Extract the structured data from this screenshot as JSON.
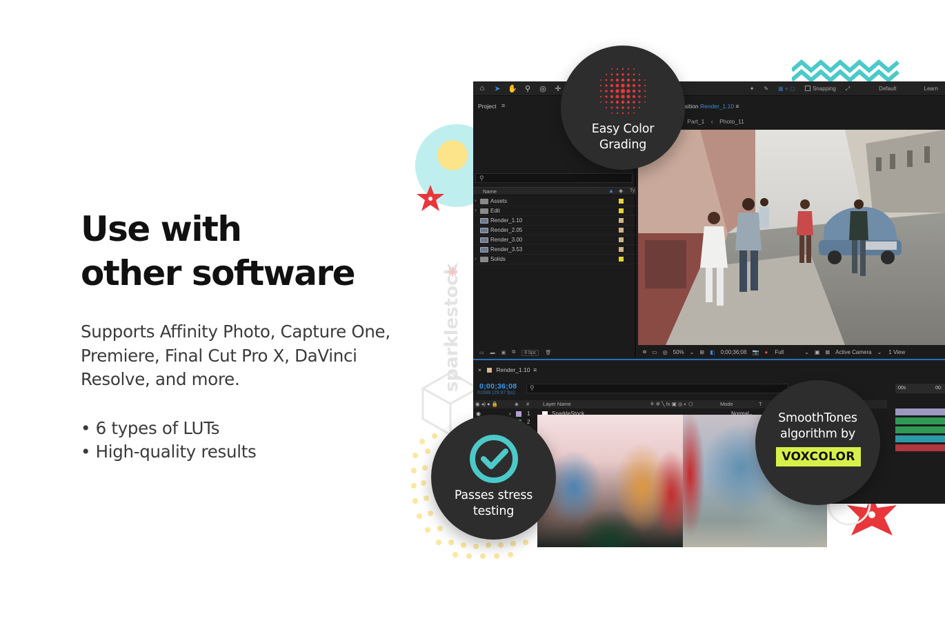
{
  "headline": {
    "line1": "Use with",
    "line2": "other software"
  },
  "description": {
    "line1": "Supports Affinity Photo, Capture One,",
    "line2": "Premiere, Final Cut Pro X, DaVinci",
    "line3": "Resolve, and more."
  },
  "bullets": [
    "• 6 types of LUTs",
    "• High-quality results"
  ],
  "watermark": "sparklestock",
  "badges": {
    "color_grading": {
      "line1": "Easy Color",
      "line2": "Grading"
    },
    "stress": {
      "line1": "Passes stress",
      "line2": "testing"
    },
    "smooth": {
      "line1": "SmoothTones",
      "line2": "algorithm by",
      "brand": "VOXCOLOR"
    }
  },
  "colors": {
    "accent_teal": "#4cc9c9",
    "accent_red": "#e8363b",
    "brand_lime": "#d8f14a",
    "badge_bg": "#2d2d2d",
    "accent_blue": "#3a8bdc"
  },
  "app": {
    "toolbar": {
      "snapping": "Snapping",
      "workspace": "Default",
      "learn": "Learn"
    },
    "project": {
      "title": "Project",
      "columns": {
        "name": "Name",
        "type": "Ty"
      },
      "files": [
        {
          "name": "Assets",
          "kind": "folder",
          "label": "#e8d23a"
        },
        {
          "name": "Edit",
          "kind": "folder",
          "label": "#e8d23a"
        },
        {
          "name": "Render_1.10",
          "kind": "comp",
          "label": "#cdb38a"
        },
        {
          "name": "Render_2.05",
          "kind": "comp",
          "label": "#cdb38a"
        },
        {
          "name": "Render_3.00",
          "kind": "comp",
          "label": "#cdb38a"
        },
        {
          "name": "Render_3.53",
          "kind": "comp",
          "label": "#cdb38a"
        },
        {
          "name": "Solids",
          "kind": "folder",
          "label": "#e8d23a"
        }
      ],
      "bpc": "8 bpc"
    },
    "composition": {
      "title_prefix": "osition",
      "title_name": "Render_1.10",
      "crumb1": "Part_1",
      "crumb2": "Photo_11",
      "zoom": "50%",
      "timecode": "0;00;36;08",
      "resolution": "Full",
      "camera": "Active Camera",
      "views": "1 View"
    },
    "timeline": {
      "tab": "Render_1.10",
      "time": "0;00;36;08",
      "fps": "01088 (29.97 fps)",
      "columns": {
        "layer_name": "Layer Name",
        "mode": "Mode",
        "t": "T"
      },
      "layers": [
        {
          "num": "1",
          "name": "SparkleStock",
          "mode": "Normal"
        },
        {
          "num": "2",
          "name": "",
          "mode": ""
        }
      ],
      "ruler_start": ":00s",
      "ruler_next": "00:"
    }
  }
}
